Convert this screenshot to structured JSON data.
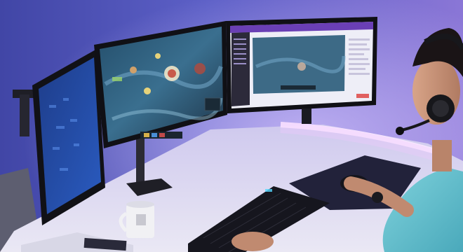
{
  "scene": {
    "description_colors": {
      "wall": "#5a5fc2",
      "wall_glow": "#b79ee8",
      "desk": "#dcd8ef",
      "led_strip": "#f3dcff",
      "monitor_bezel": "#15151c",
      "game_map": "#2f5d7a",
      "stream_ui": "#efeff6",
      "skin": "#c99377",
      "shirt": "#5fbfcf",
      "headset": "#17171b",
      "keyboard": "#1a1a22",
      "mouse_pad": "#23233a",
      "mug": "#f1f1f4"
    },
    "icons": [
      "monitor",
      "game-screen",
      "stream-dashboard",
      "headset",
      "keyboard",
      "mouse",
      "mug",
      "person"
    ]
  }
}
